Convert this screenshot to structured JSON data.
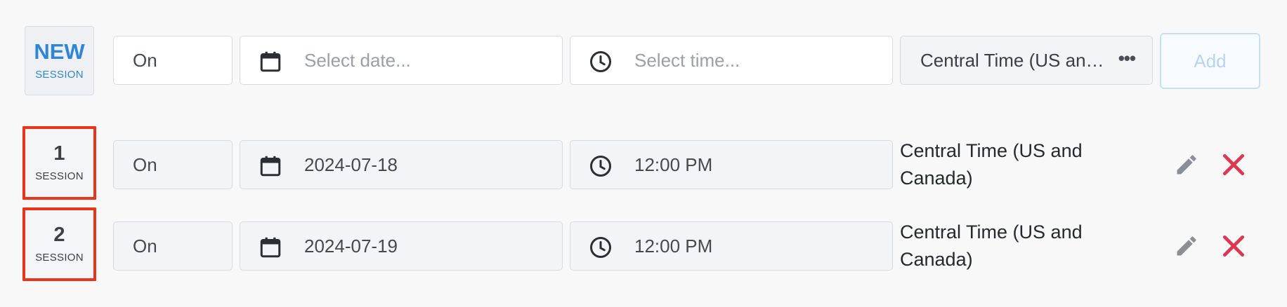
{
  "new_session": {
    "badge_number": "NEW",
    "badge_label": "SESSION",
    "mode": "On",
    "date_placeholder": "Select date...",
    "time_placeholder": "Select time...",
    "timezone": "Central Time (US an…",
    "add_label": "Add"
  },
  "sessions": [
    {
      "number": "1",
      "label": "SESSION",
      "mode": "On",
      "date": "2024-07-18",
      "time": "12:00 PM",
      "timezone": "Central Time (US and Canada)"
    },
    {
      "number": "2",
      "label": "SESSION",
      "mode": "On",
      "date": "2024-07-19",
      "time": "12:00 PM",
      "timezone": "Central Time (US and Canada)"
    }
  ],
  "colors": {
    "accent": "#2f86d6",
    "highlight_border": "#e8361d",
    "delete": "#e0364f",
    "edit": "#8a8f96"
  },
  "icons": {
    "date": "calendar-icon",
    "time": "clock-icon",
    "more": "ellipsis-icon",
    "edit": "pencil-icon",
    "delete": "close-icon"
  }
}
